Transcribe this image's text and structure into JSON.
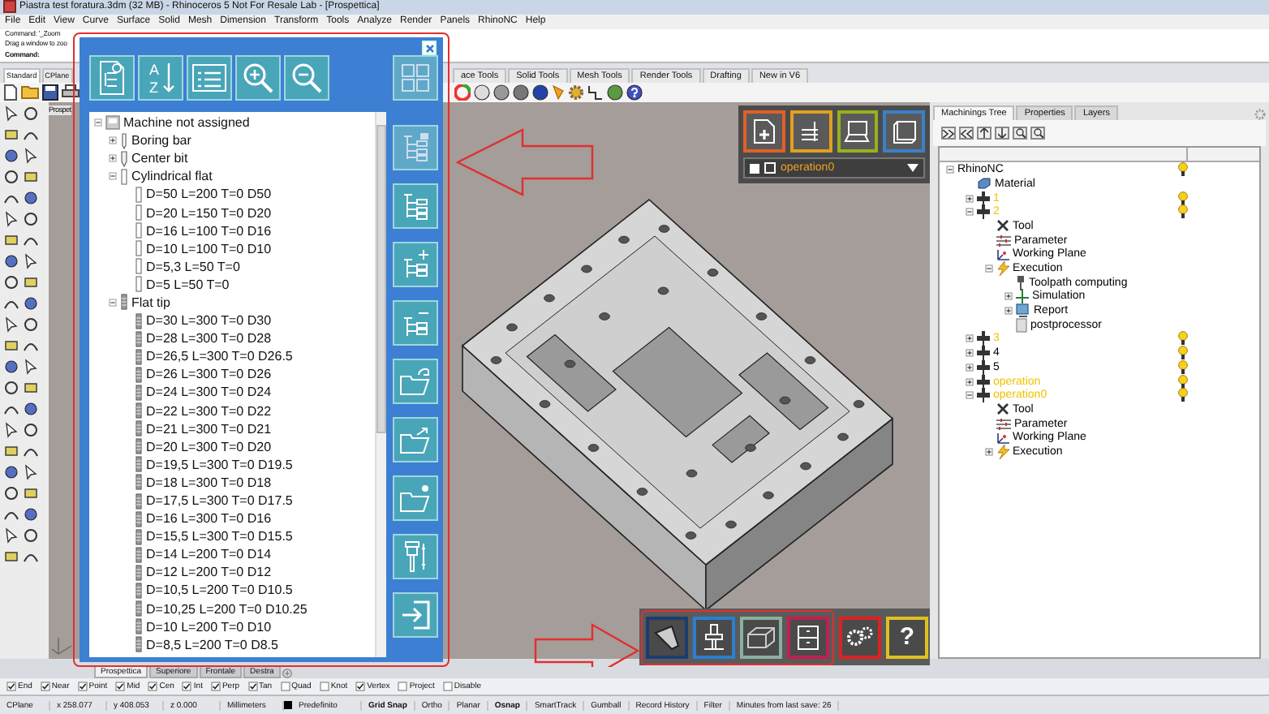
{
  "window": {
    "title": "Piastra test foratura.3dm (32 MB) - Rhinoceros 5 Not For Resale Lab - [Prospettica]"
  },
  "menu": [
    "File",
    "Edit",
    "View",
    "Curve",
    "Surface",
    "Solid",
    "Mesh",
    "Dimension",
    "Transform",
    "Tools",
    "Analyze",
    "Render",
    "Panels",
    "RhinoNC",
    "Help"
  ],
  "command_history": [
    "Command: '_Zoom",
    "Drag a window to zoo"
  ],
  "command_prompt": "Command:",
  "toolbar_tabs_left": [
    {
      "label": "Standard",
      "selected": true
    },
    {
      "label": "CPlane",
      "selected": false
    }
  ],
  "toolbar_tabs_right": [
    {
      "label": "ace Tools",
      "selected": false
    },
    {
      "label": "Solid Tools",
      "selected": false
    },
    {
      "label": "Mesh Tools",
      "selected": false
    },
    {
      "label": "Render Tools",
      "selected": false
    },
    {
      "label": "Drafting",
      "selected": false
    },
    {
      "label": "New in V6",
      "selected": false
    }
  ],
  "viewport": {
    "title": "Prospet"
  },
  "tool_library": {
    "sort_letters": [
      "A",
      "Z"
    ],
    "tree": [
      {
        "label": "Machine not assigned",
        "kind": "machine",
        "expanded": true,
        "children": [
          {
            "label": "Boring bar",
            "kind": "boring_bar",
            "expanded": false
          },
          {
            "label": "Center bit",
            "kind": "center_bit",
            "expanded": false
          },
          {
            "label": "Cylindrical flat",
            "kind": "cylinder",
            "expanded": true,
            "children": [
              {
                "label": "D=50 L=200 T=0 D50",
                "kind": "cylinder"
              },
              {
                "label": "D=20 L=150 T=0 D20",
                "kind": "cylinder"
              },
              {
                "label": "D=16 L=100 T=0 D16",
                "kind": "cylinder"
              },
              {
                "label": "D=10 L=100 T=0 D10",
                "kind": "cylinder"
              },
              {
                "label": "D=5,3 L=50 T=0",
                "kind": "cylinder"
              },
              {
                "label": "D=5 L=50 T=0",
                "kind": "cylinder"
              }
            ]
          },
          {
            "label": "Flat tip",
            "kind": "knurled",
            "expanded": true,
            "children": [
              {
                "label": "D=30 L=300 T=0 D30",
                "kind": "knurled"
              },
              {
                "label": "D=28 L=300 T=0 D28",
                "kind": "knurled"
              },
              {
                "label": "D=26,5 L=300 T=0 D26.5",
                "kind": "knurled"
              },
              {
                "label": "D=26 L=300 T=0 D26",
                "kind": "knurled"
              },
              {
                "label": "D=24 L=300 T=0 D24",
                "kind": "knurled"
              },
              {
                "label": "D=22 L=300 T=0 D22",
                "kind": "knurled"
              },
              {
                "label": "D=21 L=300 T=0 D21",
                "kind": "knurled"
              },
              {
                "label": "D=20 L=300 T=0 D20",
                "kind": "knurled"
              },
              {
                "label": "D=19,5 L=300 T=0 D19.5",
                "kind": "knurled"
              },
              {
                "label": "D=18 L=300 T=0 D18",
                "kind": "knurled"
              },
              {
                "label": "D=17,5 L=300 T=0 D17.5",
                "kind": "knurled"
              },
              {
                "label": "D=16 L=300 T=0 D16",
                "kind": "knurled"
              },
              {
                "label": "D=15,5 L=300 T=0 D15.5",
                "kind": "knurled"
              },
              {
                "label": "D=14 L=200 T=0 D14",
                "kind": "knurled"
              },
              {
                "label": "D=12 L=200 T=0 D12",
                "kind": "knurled"
              },
              {
                "label": "D=10,5 L=200 T=0 D10.5",
                "kind": "knurled"
              },
              {
                "label": "D=10,25 L=200 T=0 D10.25",
                "kind": "knurled"
              },
              {
                "label": "D=10 L=200 T=0 D10",
                "kind": "knurled"
              },
              {
                "label": "D=8,5 L=200 T=0 D8.5",
                "kind": "knurled"
              }
            ]
          }
        ]
      }
    ]
  },
  "operation_selector": {
    "value": "operation0"
  },
  "bottom_toolbar": {
    "help_label": "?"
  },
  "side_panel": {
    "tabs": [
      {
        "label": "Machinings Tree",
        "selected": true
      },
      {
        "label": "Properties",
        "selected": false
      },
      {
        "label": "Layers",
        "selected": false
      }
    ],
    "tree": [
      {
        "label": "RhinoNC",
        "expanded": true,
        "lamp": true,
        "children": [
          {
            "label": "Material",
            "kind": "material"
          },
          {
            "label": "1",
            "kind": "machining",
            "expanded": false,
            "lamp": true,
            "color": "#f2c200"
          },
          {
            "label": "2",
            "kind": "machining",
            "expanded": true,
            "lamp": true,
            "color": "#f2c200",
            "children": [
              {
                "label": "Tool",
                "kind": "tool"
              },
              {
                "label": "Parameter",
                "kind": "parameter"
              },
              {
                "label": "Working Plane",
                "kind": "plane"
              },
              {
                "label": "Execution",
                "kind": "execution",
                "expanded": true,
                "children": [
                  {
                    "label": "Toolpath computing",
                    "kind": "toolpath"
                  },
                  {
                    "label": "Simulation",
                    "kind": "simulation",
                    "expanded": false
                  },
                  {
                    "label": "Report",
                    "kind": "report",
                    "expanded": false
                  },
                  {
                    "label": "postprocessor",
                    "kind": "post"
                  }
                ]
              }
            ]
          },
          {
            "label": "3",
            "kind": "machining",
            "expanded": false,
            "lamp": true,
            "color": "#f2c200"
          },
          {
            "label": "4",
            "kind": "machining",
            "expanded": false,
            "lamp": true,
            "color": "#000000"
          },
          {
            "label": "5",
            "kind": "machining",
            "expanded": false,
            "lamp": true,
            "color": "#000000"
          },
          {
            "label": "operation",
            "kind": "machining",
            "expanded": false,
            "lamp": true,
            "color": "#f2c200"
          },
          {
            "label": "operation0",
            "kind": "machining",
            "expanded": true,
            "lamp": true,
            "color": "#f2c200",
            "children": [
              {
                "label": "Tool",
                "kind": "tool"
              },
              {
                "label": "Parameter",
                "kind": "parameter"
              },
              {
                "label": "Working Plane",
                "kind": "plane"
              },
              {
                "label": "Execution",
                "kind": "execution",
                "expanded": false
              }
            ]
          }
        ]
      }
    ]
  },
  "viewport_tabs": [
    {
      "label": "Prospettica",
      "selected": true
    },
    {
      "label": "Superiore",
      "selected": false
    },
    {
      "label": "Frontale",
      "selected": false
    },
    {
      "label": "Destra",
      "selected": false
    }
  ],
  "osnaps": [
    {
      "label": "End",
      "checked": true
    },
    {
      "label": "Near",
      "checked": true
    },
    {
      "label": "Point",
      "checked": true
    },
    {
      "label": "Mid",
      "checked": true
    },
    {
      "label": "Cen",
      "checked": true
    },
    {
      "label": "Int",
      "checked": true
    },
    {
      "label": "Perp",
      "checked": true
    },
    {
      "label": "Tan",
      "checked": true
    },
    {
      "label": "Quad",
      "checked": false
    },
    {
      "label": "Knot",
      "checked": false
    },
    {
      "label": "Vertex",
      "checked": true
    },
    {
      "label": "Project",
      "checked": false
    },
    {
      "label": "Disable",
      "checked": false
    }
  ],
  "status_bar": {
    "cplane": "CPlane",
    "x": "x 258.077",
    "y": "y 408.053",
    "z": "z 0.000",
    "units": "Millimeters",
    "layer": "Predefinito",
    "toggles": [
      {
        "label": "Grid Snap",
        "on": true
      },
      {
        "label": "Ortho",
        "on": false
      },
      {
        "label": "Planar",
        "on": false
      },
      {
        "label": "Osnap",
        "on": true
      },
      {
        "label": "SmartTrack",
        "on": false
      },
      {
        "label": "Gumball",
        "on": false
      },
      {
        "label": "Record History",
        "on": false
      },
      {
        "label": "Filter",
        "on": false
      }
    ],
    "save_info": "Minutes from last save: 26"
  }
}
